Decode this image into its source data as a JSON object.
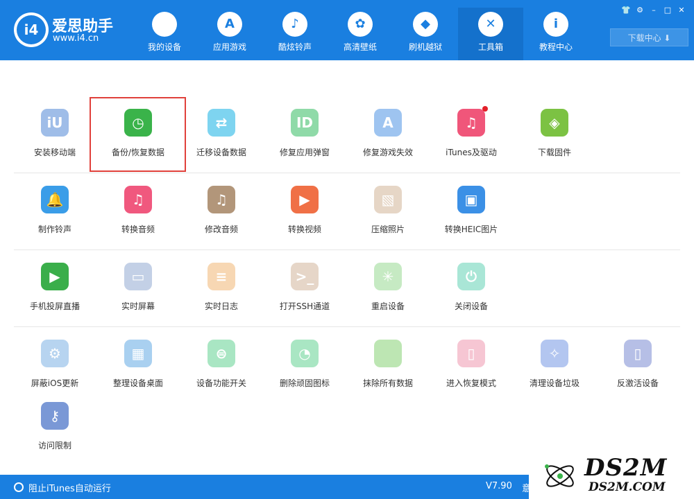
{
  "brand": {
    "name": "爱思助手",
    "url": "www.i4.cn",
    "logo_text": "i4"
  },
  "nav": [
    {
      "label": "我的设备",
      "icon": "apple-icon",
      "glyph": ""
    },
    {
      "label": "应用游戏",
      "icon": "app-store-icon",
      "glyph": "A"
    },
    {
      "label": "酷炫铃声",
      "icon": "bell-icon",
      "glyph": "♪"
    },
    {
      "label": "高清壁纸",
      "icon": "flower-icon",
      "glyph": "✿"
    },
    {
      "label": "刷机越狱",
      "icon": "dropbox-icon",
      "glyph": "◆"
    },
    {
      "label": "工具箱",
      "icon": "tools-icon",
      "glyph": "✕",
      "active": true
    },
    {
      "label": "教程中心",
      "icon": "info-icon",
      "glyph": "i"
    }
  ],
  "window_controls": [
    "shirt-icon",
    "gear-icon",
    "minimize-icon",
    "maximize-icon",
    "close-icon"
  ],
  "download_center": "下载中心 ⬇",
  "tools": [
    {
      "label": "安装移动端",
      "icon": "i4-app-icon",
      "color": "#9fbde8",
      "glyph": "iU"
    },
    {
      "label": "备份/恢复数据",
      "icon": "backup-restore-icon",
      "color": "#3ab34a",
      "glyph": "◷"
    },
    {
      "label": "迁移设备数据",
      "icon": "migrate-icon",
      "color": "#7ed4f0",
      "glyph": "⇄"
    },
    {
      "label": "修复应用弹窗",
      "icon": "apple-id-icon",
      "color": "#8fdaa8",
      "glyph": "ID"
    },
    {
      "label": "修复游戏失效",
      "icon": "app-store-repair-icon",
      "color": "#9ec4f0",
      "glyph": "A"
    },
    {
      "label": "iTunes及驱动",
      "icon": "itunes-icon",
      "color": "#f0567a",
      "glyph": "♫",
      "badge": true
    },
    {
      "label": "下载固件",
      "icon": "firmware-box-icon",
      "color": "#7cc243",
      "glyph": "◈"
    },
    {
      "label": "制作铃声",
      "icon": "ringtone-icon",
      "color": "#3a9de8",
      "glyph": "🔔"
    },
    {
      "label": "转换音频",
      "icon": "audio-convert-icon",
      "color": "#f0587e",
      "glyph": "♫"
    },
    {
      "label": "修改音频",
      "icon": "audio-edit-icon",
      "color": "#b2967a",
      "glyph": "♫"
    },
    {
      "label": "转换视频",
      "icon": "video-convert-icon",
      "color": "#f07046",
      "glyph": "▶"
    },
    {
      "label": "压缩照片",
      "icon": "photo-compress-icon",
      "color": "#e6d6c6",
      "glyph": "▧"
    },
    {
      "label": "转换HEIC图片",
      "icon": "heic-convert-icon",
      "color": "#3b90e6",
      "glyph": "▣"
    },
    {
      "label": "手机投屏直播",
      "icon": "screen-mirror-icon",
      "color": "#3aae4a",
      "glyph": "▶"
    },
    {
      "label": "实时屏幕",
      "icon": "live-screen-icon",
      "color": "#c3d0e6",
      "glyph": "▭"
    },
    {
      "label": "实时日志",
      "icon": "live-log-icon",
      "color": "#f7d7b3",
      "glyph": "≡"
    },
    {
      "label": "打开SSH通道",
      "icon": "ssh-icon",
      "color": "#e6d6c8",
      "glyph": ">_"
    },
    {
      "label": "重启设备",
      "icon": "reboot-icon",
      "color": "#c6eac3",
      "glyph": "✳"
    },
    {
      "label": "关闭设备",
      "icon": "power-icon",
      "color": "#a9e6d6",
      "glyph": "⏻"
    },
    {
      "label": "屏蔽iOS更新",
      "icon": "block-update-icon",
      "color": "#b7d4f0",
      "glyph": "⚙"
    },
    {
      "label": "整理设备桌面",
      "icon": "desktop-organize-icon",
      "color": "#a9d0f0",
      "glyph": "▦"
    },
    {
      "label": "设备功能开关",
      "icon": "feature-toggle-icon",
      "color": "#a9e6c3",
      "glyph": "⊜"
    },
    {
      "label": "删除顽固图标",
      "icon": "delete-icon-icon",
      "color": "#a9e6c3",
      "glyph": "◔"
    },
    {
      "label": "抹除所有数据",
      "icon": "erase-data-icon",
      "color": "#bde6b3",
      "glyph": ""
    },
    {
      "label": "进入恢复模式",
      "icon": "recovery-mode-icon",
      "color": "#f6c6d3",
      "glyph": "▯"
    },
    {
      "label": "清理设备垃圾",
      "icon": "clean-junk-icon",
      "color": "#b3c6f0",
      "glyph": "✧"
    },
    {
      "label": "反激活设备",
      "icon": "deactivate-icon",
      "color": "#b6bfe6",
      "glyph": "▯"
    },
    {
      "label": "访问限制",
      "icon": "restriction-key-icon",
      "color": "#7a98d6",
      "glyph": "⚷"
    }
  ],
  "footer": {
    "itunes_toggle": "阻止iTunes自动运行",
    "version": "V7.90",
    "extra": "意"
  },
  "watermark": {
    "title": "DS2M",
    "url": "DS2M.COM"
  },
  "colors": {
    "primary": "#1a7fe0",
    "highlight": "#e0403a"
  }
}
